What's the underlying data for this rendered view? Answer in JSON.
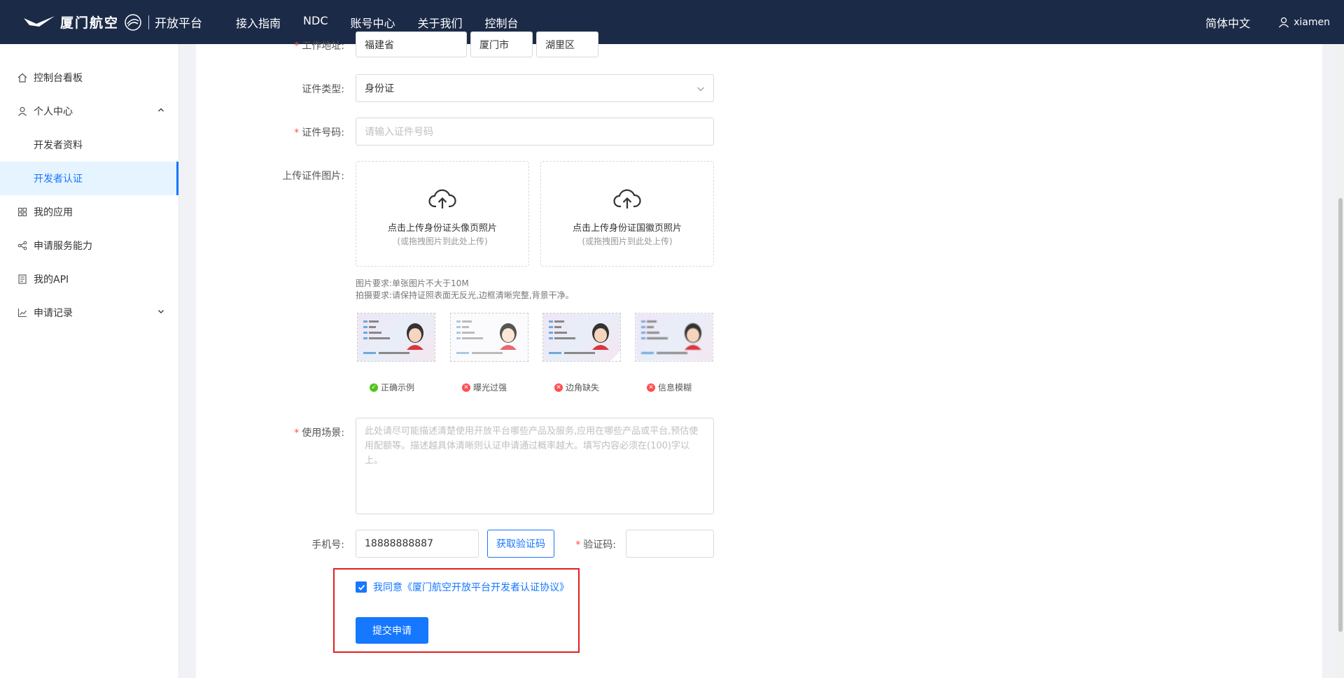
{
  "header": {
    "logo_text": "厦门航空",
    "logo_sub": "开放平台",
    "nav": [
      "接入指南",
      "NDC",
      "账号中心",
      "关于我们",
      "控制台"
    ],
    "language": "简体中文",
    "username": "xiamen"
  },
  "sidebar": {
    "items": [
      {
        "label": "控制台看板",
        "icon": "home-icon"
      },
      {
        "label": "个人中心",
        "icon": "user-icon"
      },
      {
        "label": "开发者资料"
      },
      {
        "label": "开发者认证"
      },
      {
        "label": "我的应用",
        "icon": "apps-icon"
      },
      {
        "label": "申请服务能力",
        "icon": "share-icon"
      },
      {
        "label": "我的API",
        "icon": "document-icon"
      },
      {
        "label": "申请记录",
        "icon": "chart-icon"
      }
    ]
  },
  "form": {
    "address": {
      "label": "工作地址:",
      "province": "福建省",
      "city": "厦门市",
      "district": "湖里区"
    },
    "id_type": {
      "label": "证件类型:",
      "value": "身份证"
    },
    "id_number": {
      "label": "证件号码:",
      "placeholder": "请输入证件号码"
    },
    "upload": {
      "label": "上传证件图片:",
      "front_title": "点击上传身份证头像页照片",
      "front_hint": "(或拖拽图片到此处上传)",
      "back_title": "点击上传身份证国徽页照片",
      "back_hint": "(或拖拽图片到此处上传)",
      "tip1": "图片要求:单张图片不大于10M",
      "tip2": "拍摄要求:请保持证照表面无反光,边框清晰完整,背景干净。"
    },
    "samples": [
      {
        "caption": "正确示例",
        "status": "ok"
      },
      {
        "caption": "曝光过强",
        "status": "error"
      },
      {
        "caption": "边角缺失",
        "status": "error"
      },
      {
        "caption": "信息模糊",
        "status": "error"
      }
    ],
    "scenario": {
      "label": "使用场景:",
      "placeholder": "此处请尽可能描述清楚使用开放平台哪些产品及服务,应用在哪些产品或平台,预估使用配额等。描述越具体清晰则认证申请通过概率越大。填写内容必须在(100)字以上。"
    },
    "phone": {
      "label": "手机号:",
      "value": "18888888887",
      "get_code": "获取验证码"
    },
    "code": {
      "label": "验证码:"
    },
    "agreement": "我同意《厦门航空开放平台开发者认证协议》",
    "submit": "提交申请"
  },
  "colors": {
    "primary": "#1677ff",
    "header_bg": "#1b2a47",
    "highlight": "#e02020",
    "success": "#52c41a",
    "error": "#ff4d4f"
  }
}
